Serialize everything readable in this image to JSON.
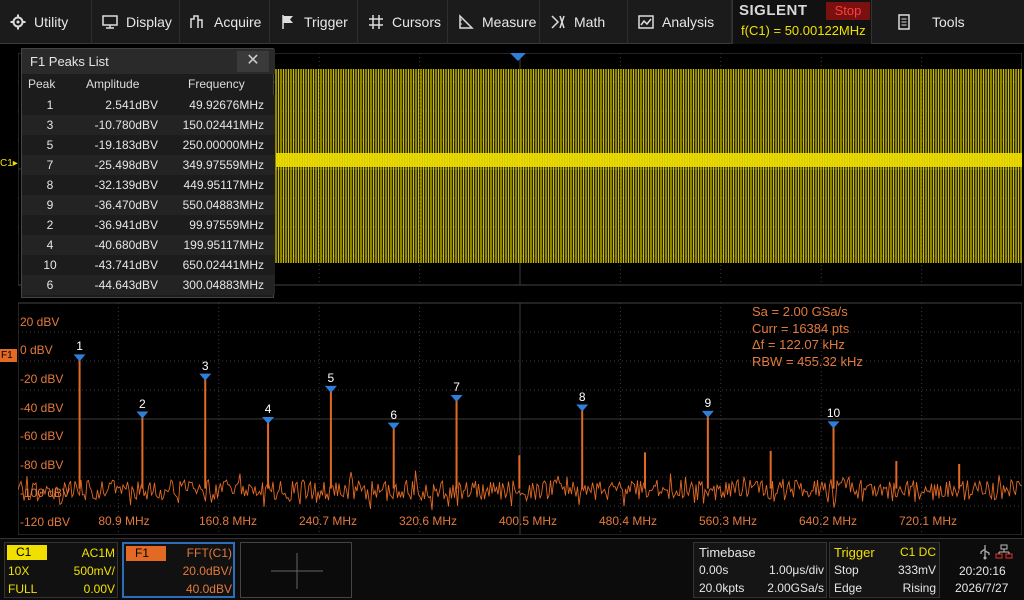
{
  "menu": [
    {
      "label": "Utility",
      "icon": "gear-icon"
    },
    {
      "label": "Display",
      "icon": "monitor-icon"
    },
    {
      "label": "Acquire",
      "icon": "acquire-icon"
    },
    {
      "label": "Trigger",
      "icon": "flag-icon"
    },
    {
      "label": "Cursors",
      "icon": "crosshair-icon"
    },
    {
      "label": "Measure",
      "icon": "ruler-icon"
    },
    {
      "label": "Math",
      "icon": "math-icon"
    },
    {
      "label": "Analysis",
      "icon": "analysis-icon"
    },
    {
      "label": "Tools",
      "icon": "tools-icon"
    }
  ],
  "brand": {
    "logo": "SIGLENT",
    "run_status": "Stop",
    "freq_readout": "f(C1) = 50.00122MHz"
  },
  "peaks": {
    "title": "F1 Peaks List",
    "close": "✕",
    "headers": {
      "peak": "Peak",
      "amplitude": "Amplitude",
      "frequency": "Frequency"
    },
    "rows": [
      {
        "peak": "1",
        "amplitude": "2.541dBV",
        "frequency": "49.92676MHz"
      },
      {
        "peak": "3",
        "amplitude": "-10.780dBV",
        "frequency": "150.02441MHz"
      },
      {
        "peak": "5",
        "amplitude": "-19.183dBV",
        "frequency": "250.00000MHz"
      },
      {
        "peak": "7",
        "amplitude": "-25.498dBV",
        "frequency": "349.97559MHz"
      },
      {
        "peak": "8",
        "amplitude": "-32.139dBV",
        "frequency": "449.95117MHz"
      },
      {
        "peak": "9",
        "amplitude": "-36.470dBV",
        "frequency": "550.04883MHz"
      },
      {
        "peak": "2",
        "amplitude": "-36.941dBV",
        "frequency": "99.97559MHz"
      },
      {
        "peak": "4",
        "amplitude": "-40.680dBV",
        "frequency": "199.95117MHz"
      },
      {
        "peak": "10",
        "amplitude": "-43.741dBV",
        "frequency": "650.02441MHz"
      },
      {
        "peak": "6",
        "amplitude": "-44.643dBV",
        "frequency": "300.04883MHz"
      }
    ]
  },
  "channel_markers": {
    "c1": "C1▸",
    "f1": "F1"
  },
  "fft_axis": {
    "db_labels": [
      "20 dBV",
      "0 dBV",
      "-20 dBV",
      "-40 dBV",
      "-60 dBV",
      "-80 dBV",
      "-100 dBV",
      "-120 dBV"
    ],
    "freq_labels": [
      "80.9 MHz",
      "160.8 MHz",
      "240.7 MHz",
      "320.6 MHz",
      "400.5 MHz",
      "480.4 MHz",
      "560.3 MHz",
      "640.2 MHz",
      "720.1 MHz"
    ]
  },
  "fft_info": {
    "sa": "Sa =  2.00 GSa/s",
    "curr": "Curr = 16384 pts",
    "df": "Δf =  122.07 kHz",
    "rbw": "RBW =  455.32 kHz"
  },
  "spectrum_peaks": [
    {
      "label": "1",
      "freq_mhz": 50.0,
      "dbv": 2.5
    },
    {
      "label": "2",
      "freq_mhz": 100.0,
      "dbv": -36.9
    },
    {
      "label": "3",
      "freq_mhz": 150.0,
      "dbv": -10.8
    },
    {
      "label": "4",
      "freq_mhz": 200.0,
      "dbv": -40.7
    },
    {
      "label": "5",
      "freq_mhz": 250.0,
      "dbv": -19.2
    },
    {
      "label": "6",
      "freq_mhz": 300.0,
      "dbv": -44.6
    },
    {
      "label": "7",
      "freq_mhz": 350.0,
      "dbv": -25.5
    },
    {
      "label": "8",
      "freq_mhz": 450.0,
      "dbv": -32.1
    },
    {
      "label": "9",
      "freq_mhz": 550.0,
      "dbv": -36.5
    },
    {
      "label": "10",
      "freq_mhz": 650.0,
      "dbv": -43.7
    }
  ],
  "extra_spurs": [
    {
      "freq_mhz": 400.0,
      "dbv": -65
    },
    {
      "freq_mhz": 500.0,
      "dbv": -63
    },
    {
      "freq_mhz": 600.0,
      "dbv": -62
    },
    {
      "freq_mhz": 700.0,
      "dbv": -69
    },
    {
      "freq_mhz": 750.0,
      "dbv": -71
    }
  ],
  "c1_box": {
    "tag": "C1",
    "coupling": "AC1M",
    "probe": "10X",
    "scale": "500mV/",
    "bw": "FULL",
    "offset": "0.00V"
  },
  "f1_box": {
    "tag": "F1",
    "func": "FFT(C1)",
    "scale": "20.0dBV/",
    "offset": "40.0dBV"
  },
  "timebase": {
    "title": "Timebase",
    "delay": "0.00s",
    "scale": "1.00μs/div",
    "points": "20.0kpts",
    "rate": "2.00GSa/s"
  },
  "trigger": {
    "title": "Trigger",
    "source": "C1 DC",
    "mode": "Stop",
    "level": "333mV",
    "type": "Edge",
    "slope": "Rising"
  },
  "clock": {
    "time": "20:20:16",
    "date": "2026/7/27"
  },
  "colors": {
    "c1": "#f0e000",
    "f1": "#e26a24",
    "peak_marker": "#2f7fd8",
    "grid": "#3c3c3c"
  }
}
